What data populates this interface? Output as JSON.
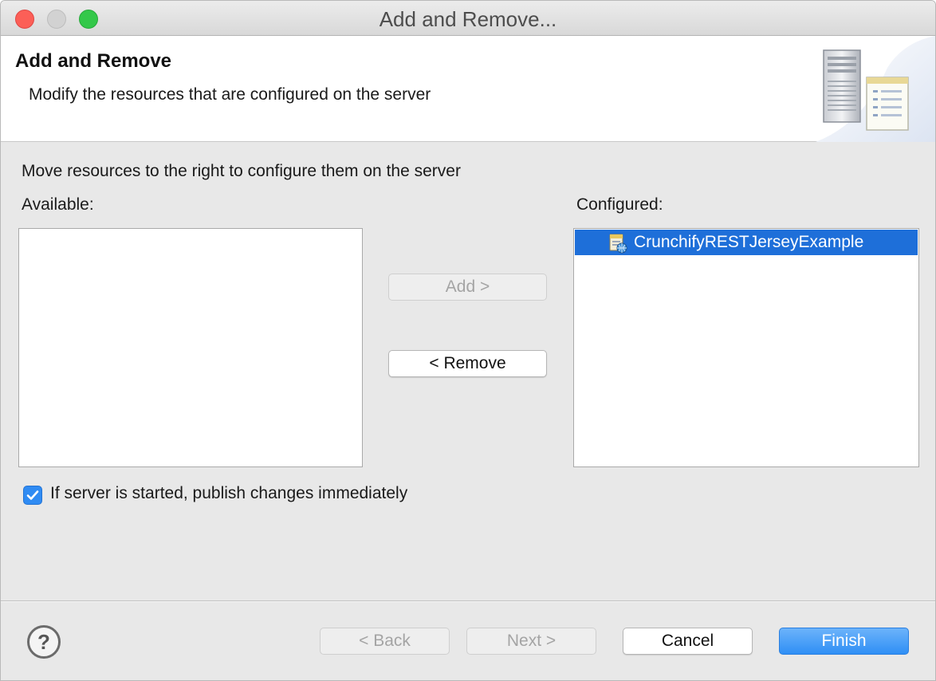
{
  "window": {
    "title": "Add and Remove..."
  },
  "banner": {
    "title": "Add and Remove",
    "description": "Modify the resources that are configured on the server"
  },
  "main": {
    "instruction": "Move resources to the right to configure them on the server",
    "available_label": "Available:",
    "configured_label": "Configured:",
    "available_items": [],
    "configured_items": [
      {
        "label": "CrunchifyRESTJerseyExample",
        "icon": "web-project-icon",
        "selected": true
      }
    ],
    "add_label": "Add >",
    "remove_label": "< Remove",
    "publish_checkbox": {
      "label": "If server is started, publish changes immediately",
      "checked": true
    }
  },
  "footer": {
    "help_icon": "help-icon",
    "back_label": "< Back",
    "next_label": "Next >",
    "cancel_label": "Cancel",
    "finish_label": "Finish"
  },
  "colors": {
    "selection": "#1e6fd9",
    "default_button": "#2f8ff5",
    "window_bg": "#e8e8e8"
  }
}
